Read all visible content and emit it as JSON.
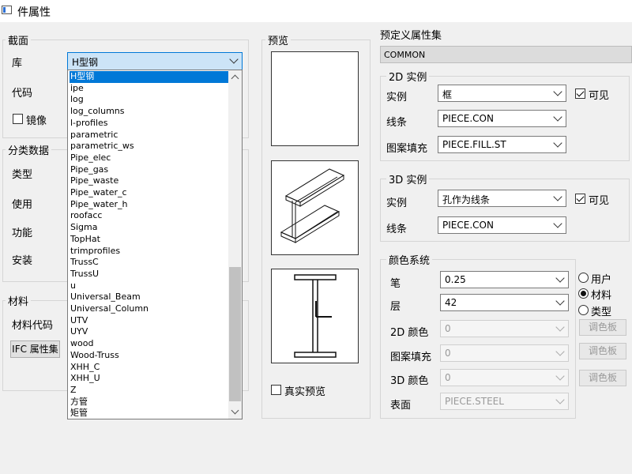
{
  "window": {
    "title": "件属性"
  },
  "section": {
    "label": "截面",
    "library_label": "库",
    "library_value": "H型钢",
    "code_label": "代码",
    "mirror_label": "镜像",
    "mirror_checked": false
  },
  "dropdown": {
    "items": [
      "H型钢",
      "ipe",
      "log",
      "log_columns",
      "l-profiles",
      "parametric",
      "parametric_ws",
      "Pipe_elec",
      "Pipe_gas",
      "Pipe_waste",
      "Pipe_water_c",
      "Pipe_water_h",
      "roofacc",
      "Sigma",
      "TopHat",
      "trimprofiles",
      "TrussC",
      "TrussU",
      "u",
      "Universal_Beam",
      "Universal_Column",
      "UTV",
      "UYV",
      "wood",
      "Wood-Truss",
      "XHH_C",
      "XHH_U",
      "Z",
      "方管",
      "矩管"
    ],
    "selected": "H型钢"
  },
  "classification": {
    "label": "分类数据",
    "type_label": "类型",
    "use_label": "使用",
    "function_label": "功能",
    "install_label": "安装"
  },
  "material": {
    "label": "材料",
    "code_label": "材料代码",
    "ifc_button": "IFC 属性集"
  },
  "preview": {
    "label": "预览",
    "real_preview_label": "真实预览",
    "real_preview_checked": false
  },
  "predefined": {
    "label": "预定义属性集",
    "value": "COMMON"
  },
  "instance2d": {
    "label": "2D 实例",
    "instance_label": "实例",
    "instance_value": "框",
    "visible_label": "可见",
    "visible_checked": true,
    "line_label": "线条",
    "line_value": "PIECE.CON",
    "fill_label": "图案填充",
    "fill_value": "PIECE.FILL.ST"
  },
  "instance3d": {
    "label": "3D 实例",
    "instance_label": "实例",
    "instance_value": "孔作为线条",
    "visible_label": "可见",
    "visible_checked": true,
    "line_label": "线条",
    "line_value": "PIECE.CON"
  },
  "color": {
    "label": "颜色系统",
    "pen_label": "笔",
    "pen_value": "0.25",
    "layer_label": "层",
    "layer_value": "42",
    "color2d_label": "2D 颜色",
    "color2d_value": "0",
    "fill_label": "图案填充",
    "fill_value": "0",
    "color3d_label": "3D 颜色",
    "color3d_value": "0",
    "surface_label": "表面",
    "surface_value": "PIECE.STEEL",
    "palette_button": "调色板",
    "radio_user": "用户",
    "radio_material": "材料",
    "radio_type": "类型",
    "radio_selected": "材料"
  }
}
